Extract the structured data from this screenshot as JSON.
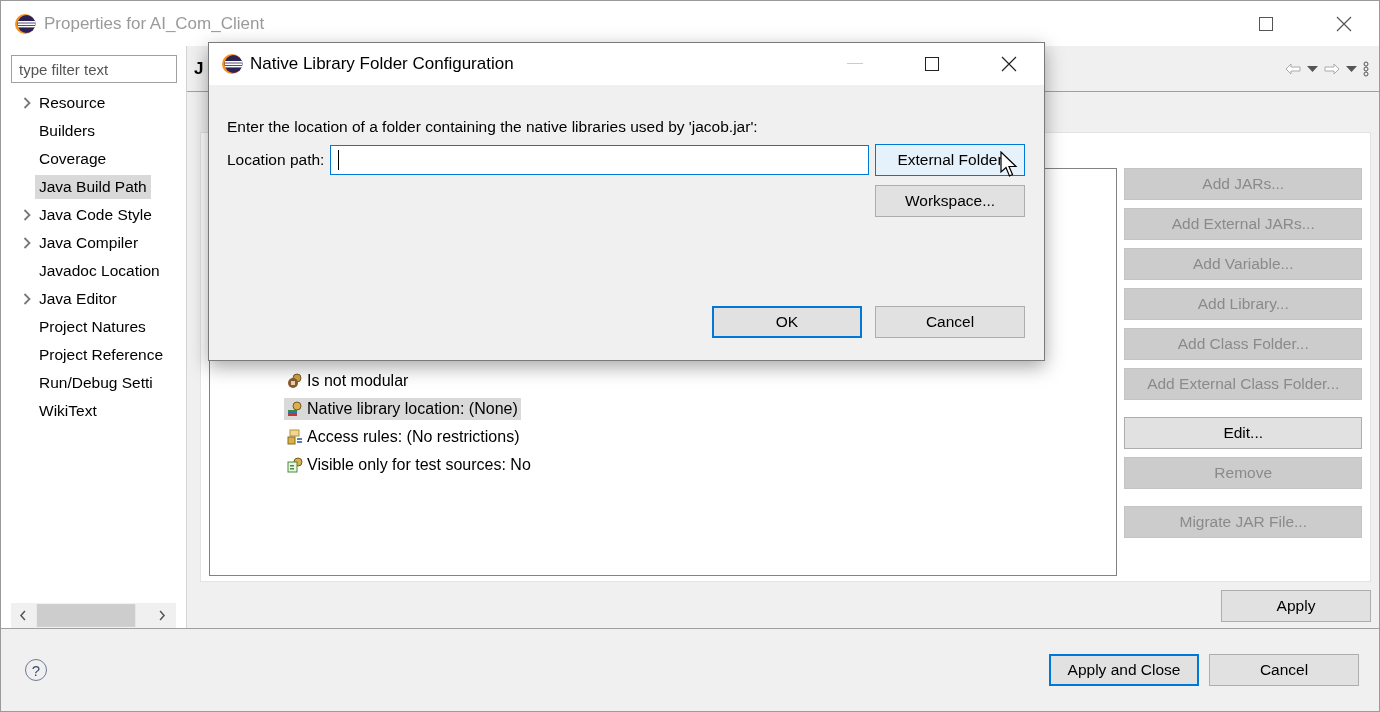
{
  "window": {
    "title": "Properties for AI_Com_Client",
    "active": false
  },
  "sidebar": {
    "filter": {
      "placeholder": "type filter text"
    },
    "items": [
      {
        "label": "Resource",
        "expandable": true,
        "selected": false
      },
      {
        "label": "Builders",
        "expandable": false,
        "selected": false
      },
      {
        "label": "Coverage",
        "expandable": false,
        "selected": false
      },
      {
        "label": "Java Build Path",
        "expandable": false,
        "selected": true
      },
      {
        "label": "Java Code Style",
        "expandable": true,
        "selected": false
      },
      {
        "label": "Java Compiler",
        "expandable": true,
        "selected": false
      },
      {
        "label": "Javadoc Location",
        "expandable": false,
        "selected": false
      },
      {
        "label": "Java Editor",
        "expandable": true,
        "selected": false
      },
      {
        "label": "Project Natures",
        "expandable": false,
        "selected": false
      },
      {
        "label": "Project Reference",
        "expandable": false,
        "selected": false
      },
      {
        "label": "Run/Debug Setti",
        "expandable": false,
        "selected": false
      },
      {
        "label": "WikiText",
        "expandable": false,
        "selected": false
      }
    ]
  },
  "page": {
    "title": "J",
    "entries": [
      {
        "label": "Is not modular",
        "kind": "module",
        "selected": false
      },
      {
        "label": "Native library location: (None)",
        "kind": "native",
        "selected": true
      },
      {
        "label": "Access rules: (No restrictions)",
        "kind": "access",
        "selected": false
      },
      {
        "label": "Visible only for test sources: No",
        "kind": "test",
        "selected": false
      }
    ],
    "button_groups": [
      [
        {
          "label": "Add JARs...",
          "disabled": true
        },
        {
          "label": "Add External JARs...",
          "disabled": true
        },
        {
          "label": "Add Variable...",
          "disabled": true
        },
        {
          "label": "Add Library...",
          "disabled": true
        },
        {
          "label": "Add Class Folder...",
          "disabled": true
        },
        {
          "label": "Add External Class Folder...",
          "disabled": true
        }
      ],
      [
        {
          "label": "Edit...",
          "disabled": false
        },
        {
          "label": "Remove",
          "disabled": true
        }
      ],
      [
        {
          "label": "Migrate JAR File...",
          "disabled": true
        }
      ]
    ],
    "apply": "Apply"
  },
  "footer": {
    "help": "?",
    "buttons": [
      {
        "label": "Apply and Close",
        "default": true
      },
      {
        "label": "Cancel",
        "default": false
      }
    ]
  },
  "dialog": {
    "title": "Native Library Folder Configuration",
    "prompt": "Enter the location of a folder containing the native libraries used by 'jacob.jar':",
    "location_label": "Location path:",
    "location": {
      "focused": true
    },
    "side_buttons": [
      {
        "label": "External Folder",
        "hovered": true
      },
      {
        "label": "Workspace...",
        "hovered": false
      }
    ],
    "actions": [
      {
        "label": "OK",
        "default": true
      },
      {
        "label": "Cancel",
        "default": false
      }
    ]
  }
}
